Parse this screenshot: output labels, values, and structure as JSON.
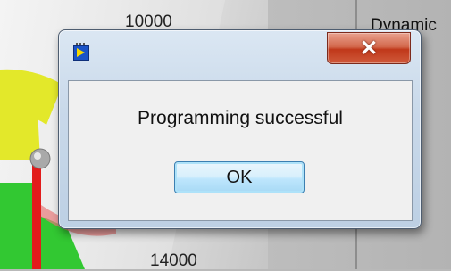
{
  "background": {
    "gauge_top_label": "10000",
    "gauge_bottom_label": "14000",
    "right_panel_label": "Dynamic"
  },
  "dialog": {
    "icon": "labview-app-icon",
    "close_label": "✕",
    "message": "Programming successful",
    "ok_label": "OK"
  },
  "colors": {
    "gauge_yellow": "#e3e82a",
    "gauge_green": "#32c832",
    "gauge_red": "#e21b1b",
    "close_button_red": "#c0381a",
    "ok_button_border": "#3c7fb1"
  }
}
